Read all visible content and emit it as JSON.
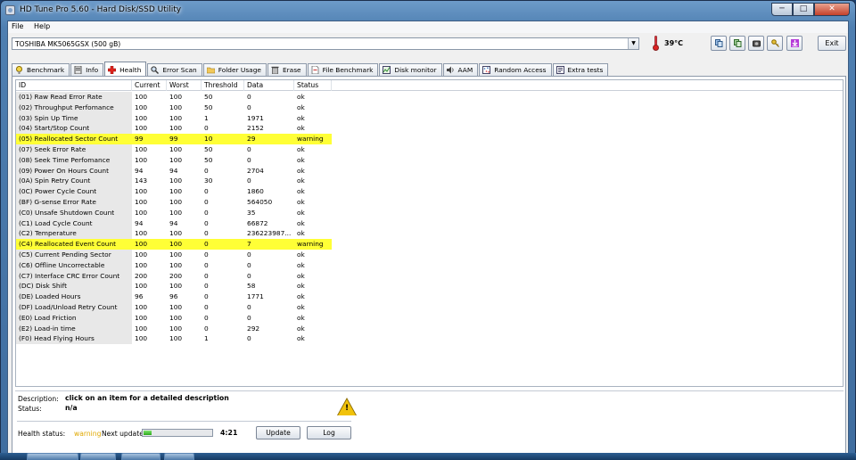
{
  "window": {
    "title": "HD Tune Pro 5.60 - Hard Disk/SSD Utility",
    "min": "─",
    "max": "□",
    "close": "✕"
  },
  "menu": {
    "file": "File",
    "help": "Help"
  },
  "toolbar": {
    "drive": "TOSHIBA MK5065GSX (500 gB)",
    "temperature": "39°C",
    "exit_label": "Exit"
  },
  "tabs": [
    "Benchmark",
    "Info",
    "Health",
    "Error Scan",
    "Folder Usage",
    "Erase",
    "File Benchmark",
    "Disk monitor",
    "AAM",
    "Random Access",
    "Extra tests"
  ],
  "table": {
    "headers": [
      "ID",
      "Current",
      "Worst",
      "Threshold",
      "Data",
      "Status"
    ],
    "rows": [
      [
        "(01) Raw Read Error Rate",
        "100",
        "100",
        "50",
        "0",
        "ok"
      ],
      [
        "(02) Throughput Perfomance",
        "100",
        "100",
        "50",
        "0",
        "ok"
      ],
      [
        "(03) Spin Up Time",
        "100",
        "100",
        "1",
        "1971",
        "ok"
      ],
      [
        "(04) Start/Stop Count",
        "100",
        "100",
        "0",
        "2152",
        "ok"
      ],
      [
        "(05) Reallocated Sector Count",
        "99",
        "99",
        "10",
        "29",
        "warning"
      ],
      [
        "(07) Seek Error Rate",
        "100",
        "100",
        "50",
        "0",
        "ok"
      ],
      [
        "(08) Seek Time Perfomance",
        "100",
        "100",
        "50",
        "0",
        "ok"
      ],
      [
        "(09) Power On Hours Count",
        "94",
        "94",
        "0",
        "2704",
        "ok"
      ],
      [
        "(0A) Spin Retry Count",
        "143",
        "100",
        "30",
        "0",
        "ok"
      ],
      [
        "(0C) Power Cycle Count",
        "100",
        "100",
        "0",
        "1860",
        "ok"
      ],
      [
        "(BF) G-sense Error Rate",
        "100",
        "100",
        "0",
        "564050",
        "ok"
      ],
      [
        "(C0) Unsafe Shutdown Count",
        "100",
        "100",
        "0",
        "35",
        "ok"
      ],
      [
        "(C1) Load Cycle Count",
        "94",
        "94",
        "0",
        "66872",
        "ok"
      ],
      [
        "(C2) Temperature",
        "100",
        "100",
        "0",
        "236223987...",
        "ok"
      ],
      [
        "(C4) Reallocated Event Count",
        "100",
        "100",
        "0",
        "7",
        "warning"
      ],
      [
        "(C5) Current Pending Sector",
        "100",
        "100",
        "0",
        "0",
        "ok"
      ],
      [
        "(C6) Offline Uncorrectable",
        "100",
        "100",
        "0",
        "0",
        "ok"
      ],
      [
        "(C7) Interface CRC Error Count",
        "200",
        "200",
        "0",
        "0",
        "ok"
      ],
      [
        "(DC) Disk Shift",
        "100",
        "100",
        "0",
        "58",
        "ok"
      ],
      [
        "(DE) Loaded Hours",
        "96",
        "96",
        "0",
        "1771",
        "ok"
      ],
      [
        "(DF) Load/Unload Retry Count",
        "100",
        "100",
        "0",
        "0",
        "ok"
      ],
      [
        "(E0) Load Friction",
        "100",
        "100",
        "0",
        "0",
        "ok"
      ],
      [
        "(E2) Load-in time",
        "100",
        "100",
        "0",
        "292",
        "ok"
      ],
      [
        "(F0) Head Flying Hours",
        "100",
        "100",
        "1",
        "0",
        "ok"
      ]
    ]
  },
  "details": {
    "description_label": "Description:",
    "description_value": "click on an item for a detailed description",
    "status_label": "Status:",
    "status_value": "n/a"
  },
  "footer": {
    "health_label": "Health status:",
    "health_value": "warning",
    "next_update_label": "Next update:",
    "progress_fraction": 0.12,
    "countdown": "4:21",
    "update_label": "Update",
    "log_label": "Log"
  },
  "colors": {
    "warning_row": "#ffff36",
    "health_warning": "#e0a800"
  },
  "icons": [
    "app-icon",
    "thermometer-icon",
    "copy-icon",
    "save-icon",
    "camera-icon",
    "key-icon",
    "download-icon",
    "warning-icon"
  ]
}
